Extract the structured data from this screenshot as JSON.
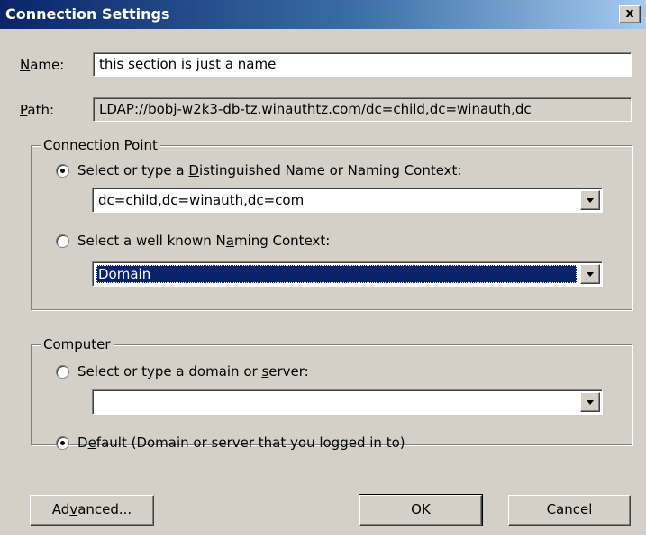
{
  "window": {
    "title": "Connection Settings",
    "close_glyph": "x"
  },
  "name_field": {
    "label_accesskey": "N",
    "label_rest": "ame:",
    "value": "this section is just a name"
  },
  "path_field": {
    "label_accesskey": "P",
    "label_rest": "ath:",
    "value": "LDAP://bobj-w2k3-db-tz.winauthtz.com/dc=child,dc=winauth,dc"
  },
  "connection_point": {
    "title": "Connection Point",
    "option_dn": {
      "before": "Select or type a ",
      "accesskey": "D",
      "after": "istinguished Name or Naming Context:",
      "checked": true
    },
    "dn_combo": {
      "value": "dc=child,dc=winauth,dc=com"
    },
    "option_known": {
      "before": "Select a well known N",
      "accesskey": "a",
      "after": "ming Context:",
      "checked": false
    },
    "known_combo": {
      "value": "Domain"
    }
  },
  "computer": {
    "title": "Computer",
    "option_server": {
      "before": "Select or type a domain or ",
      "accesskey": "s",
      "after": "erver:",
      "checked": false
    },
    "server_combo": {
      "value": ""
    },
    "option_default": {
      "before": "D",
      "accesskey": "e",
      "after": "fault (Domain or server that you logged in to)",
      "checked": true
    }
  },
  "buttons": {
    "advanced": {
      "before": "Ad",
      "accesskey": "v",
      "after": "anced..."
    },
    "ok": "OK",
    "cancel": "Cancel"
  }
}
